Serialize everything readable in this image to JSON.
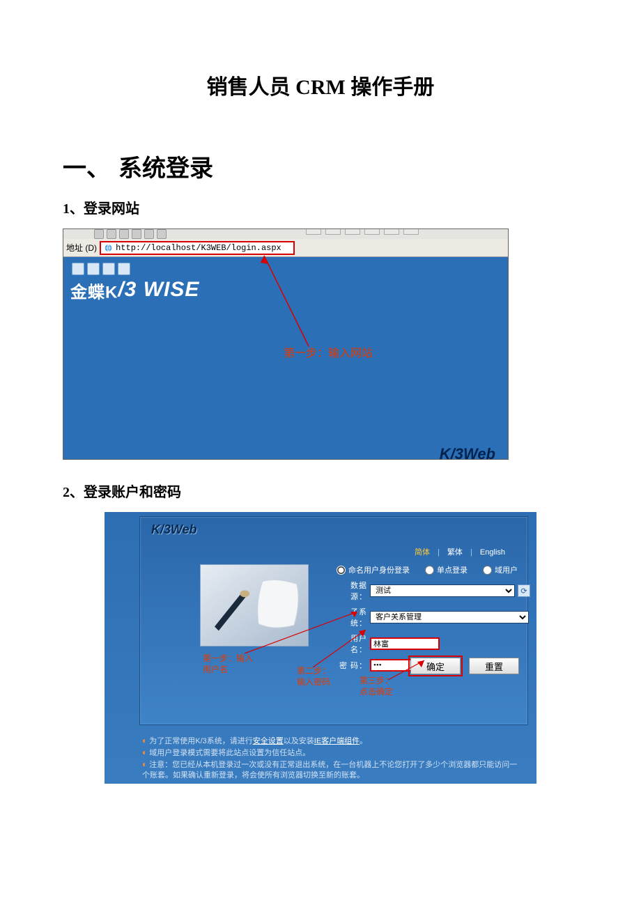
{
  "doc": {
    "title": "销售人员 CRM 操作手册",
    "section1": {
      "num": "一、",
      "title": "系统登录"
    },
    "sub1": "1、登录网站",
    "sub2": "2、登录账户和密码"
  },
  "fig1": {
    "addr_label": "地址 (D)",
    "url": "http://localhost/K3WEB/login.aspx",
    "logo_cn": "金蝶K",
    "logo_en": "/3 WISE",
    "annotation": "第一步：输入网站",
    "k3web": "K/3Web"
  },
  "fig2": {
    "logo": "K/3Web",
    "lang": {
      "simp": "简体",
      "trad": "繁体",
      "en": "English"
    },
    "radios": {
      "named": "命名用户身份登录",
      "single": "单点登录",
      "domain": "域用户"
    },
    "form": {
      "datasource_label": "数据源：",
      "datasource_value": "测试",
      "subsystem_label": "子系统：",
      "subsystem_value": "客户关系管理",
      "user_label": "用户名：",
      "user_value": "林富",
      "pwd_label": "密  码：",
      "pwd_value": "●●●"
    },
    "buttons": {
      "ok": "确定",
      "reset": "重置"
    },
    "anno": {
      "a": "第一步：输入\n用户名",
      "b": "第二步：\n输入密码",
      "c": "第三步：\n点击确定"
    },
    "notes": {
      "n1_pre": "为了正常使用K/3系统，请进行",
      "n1_link1": "安全设置",
      "n1_mid": "以及安装",
      "n1_link2": "IE客户端组件",
      "n1_post": "。",
      "n2": "域用户登录模式需要将此站点设置为信任站点。",
      "n3": "注意：您已经从本机登录过一次或没有正常退出系统，在一台机器上不论您打开了多少个浏览器都只能访问一个账套。如果确认重新登录，将会使所有浏览器切换至新的账套。"
    }
  }
}
